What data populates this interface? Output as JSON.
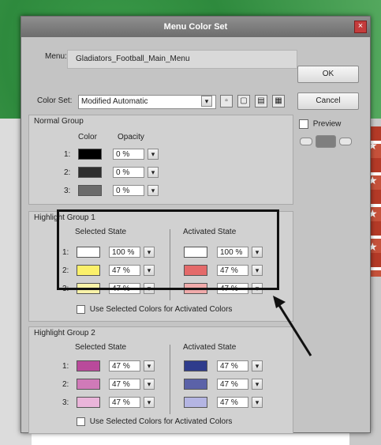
{
  "dialog": {
    "title": "Menu Color Set",
    "close_icon": "×"
  },
  "menu": {
    "label": "Menu:",
    "value": "Gladiators_Football_Main_Menu"
  },
  "color_set": {
    "label": "Color Set:",
    "value": "Modified Automatic"
  },
  "buttons": {
    "ok": "OK",
    "cancel": "Cancel"
  },
  "preview": {
    "label": "Preview"
  },
  "normal_group": {
    "title": "Normal Group",
    "col_color": "Color",
    "col_opacity": "Opacity",
    "rows": [
      {
        "label": "1:",
        "color": "#000000",
        "opacity": "0 %"
      },
      {
        "label": "2:",
        "color": "#2e2e2e",
        "opacity": "0 %"
      },
      {
        "label": "3:",
        "color": "#6b6b6b",
        "opacity": "0 %"
      }
    ]
  },
  "highlight1": {
    "title": "Highlight Group 1",
    "selected_title": "Selected State",
    "activated_title": "Activated State",
    "rows": [
      {
        "label": "1:",
        "sel_color": "#ffffff",
        "sel_op": "100 %",
        "act_color": "#ffffff",
        "act_op": "100 %"
      },
      {
        "label": "2:",
        "sel_color": "#fbf06a",
        "sel_op": "47 %",
        "act_color": "#e46a6a",
        "act_op": "47 %"
      },
      {
        "label": "3:",
        "sel_color": "#f8f3a8",
        "sel_op": "47 %",
        "act_color": "#f0aaaa",
        "act_op": "47 %"
      }
    ],
    "checkbox": "Use Selected Colors for Activated Colors"
  },
  "highlight2": {
    "title": "Highlight Group 2",
    "selected_title": "Selected State",
    "activated_title": "Activated State",
    "rows": [
      {
        "label": "1:",
        "sel_color": "#b94a9b",
        "sel_op": "47 %",
        "act_color": "#2f3c8c",
        "act_op": "47 %"
      },
      {
        "label": "2:",
        "sel_color": "#d07ab8",
        "sel_op": "47 %",
        "act_color": "#5b62a8",
        "act_op": "47 %"
      },
      {
        "label": "3:",
        "sel_color": "#eab5da",
        "sel_op": "47 %",
        "act_color": "#b4b5e3",
        "act_op": "47 %"
      }
    ],
    "checkbox": "Use Selected Colors for Activated Colors"
  }
}
